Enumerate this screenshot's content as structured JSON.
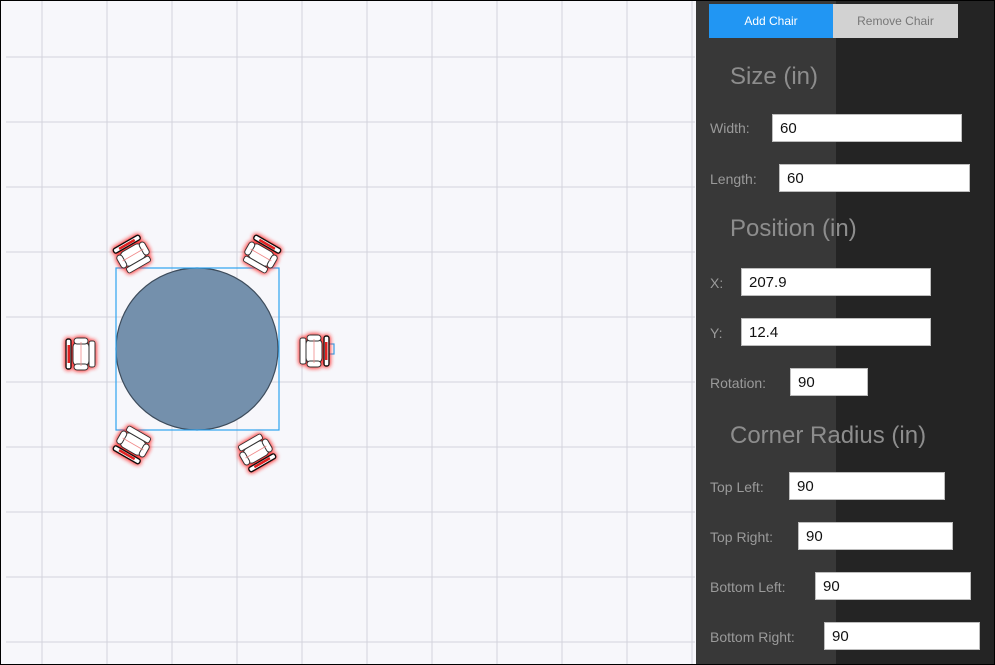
{
  "toolbar": {
    "add_chair_label": "Add Chair",
    "remove_chair_label": "Remove Chair"
  },
  "size": {
    "heading": "Size (in)",
    "width_label": "Width:",
    "width_value": "60",
    "length_label": "Length:",
    "length_value": "60"
  },
  "position": {
    "heading": "Position (in)",
    "x_label": "X:",
    "x_value": "207.9",
    "y_label": "Y:",
    "y_value": "12.4",
    "rotation_label": "Rotation:",
    "rotation_value": "90"
  },
  "corner_radius": {
    "heading": "Corner Radius (in)",
    "top_left_label": "Top Left:",
    "top_left_value": "90",
    "top_right_label": "Top Right:",
    "top_right_value": "90",
    "bottom_left_label": "Bottom Left:",
    "bottom_left_value": "90",
    "bottom_right_label": "Bottom Right:",
    "bottom_right_value": "90"
  },
  "colors": {
    "accent": "#2196f3",
    "table_fill": "#7490ac",
    "selection": "#2fa4f0",
    "chair_highlight": "#ff3b3b"
  }
}
